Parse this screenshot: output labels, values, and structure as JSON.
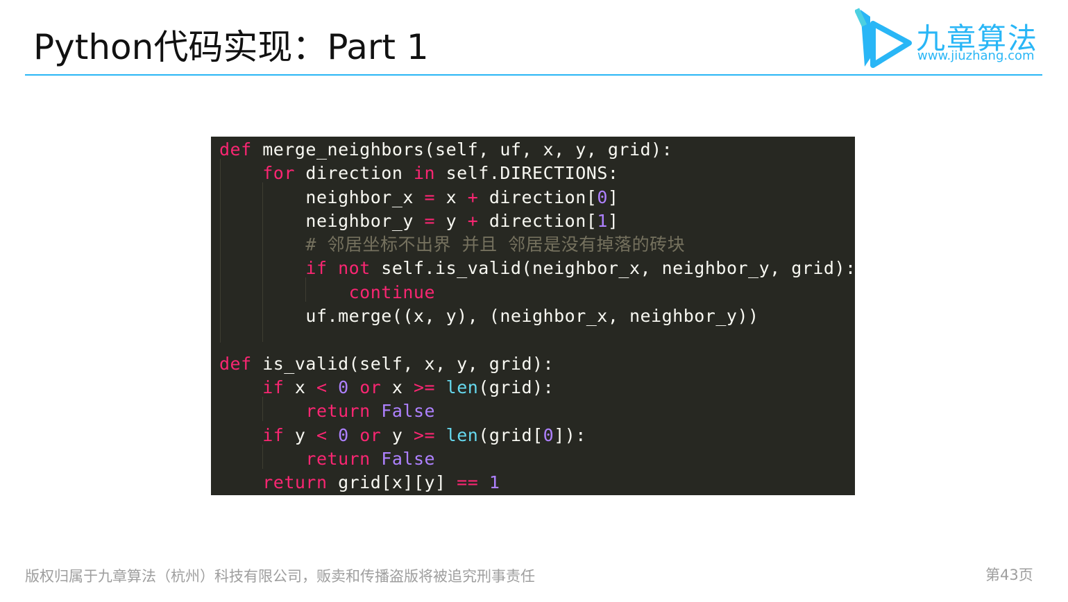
{
  "slide": {
    "title": "Python代码实现：Part 1",
    "page_label": "第43页",
    "footer_text": "版权归属于九章算法（杭州）科技有限公司，贩卖和传播盗版将被追究刑事责任"
  },
  "logo": {
    "name": "九章算法",
    "url": "www.jiuzhang.com",
    "icon": "jiuzhang-logo-icon"
  },
  "code": {
    "lines": [
      [
        {
          "t": "def",
          "c": "kw"
        },
        {
          "t": " merge_neighbors(self, uf, x, y, grid):",
          "c": ""
        }
      ],
      [
        {
          "t": "    ",
          "c": ""
        },
        {
          "t": "for",
          "c": "kw"
        },
        {
          "t": " direction ",
          "c": ""
        },
        {
          "t": "in",
          "c": "kw"
        },
        {
          "t": " self.DIRECTIONS:",
          "c": ""
        }
      ],
      [
        {
          "t": "        neighbor_x ",
          "c": ""
        },
        {
          "t": "=",
          "c": "op"
        },
        {
          "t": " x ",
          "c": ""
        },
        {
          "t": "+",
          "c": "op"
        },
        {
          "t": " direction[",
          "c": ""
        },
        {
          "t": "0",
          "c": "num"
        },
        {
          "t": "]",
          "c": ""
        }
      ],
      [
        {
          "t": "        neighbor_y ",
          "c": ""
        },
        {
          "t": "=",
          "c": "op"
        },
        {
          "t": " y ",
          "c": ""
        },
        {
          "t": "+",
          "c": "op"
        },
        {
          "t": " direction[",
          "c": ""
        },
        {
          "t": "1",
          "c": "num"
        },
        {
          "t": "]",
          "c": ""
        }
      ],
      [
        {
          "t": "        ",
          "c": ""
        },
        {
          "t": "# 邻居坐标不出界 并且 邻居是没有掉落的砖块",
          "c": "cmt"
        }
      ],
      [
        {
          "t": "        ",
          "c": ""
        },
        {
          "t": "if",
          "c": "kw"
        },
        {
          "t": " ",
          "c": ""
        },
        {
          "t": "not",
          "c": "kw"
        },
        {
          "t": " self.is_valid(neighbor_x, neighbor_y, grid):",
          "c": ""
        }
      ],
      [
        {
          "t": "            ",
          "c": ""
        },
        {
          "t": "continue",
          "c": "kw"
        }
      ],
      [
        {
          "t": "        uf.merge((x, y), (neighbor_x, neighbor_y))",
          "c": ""
        }
      ],
      [
        {
          "t": "",
          "c": ""
        }
      ],
      [
        {
          "t": "def",
          "c": "kw"
        },
        {
          "t": " is_valid(self, x, y, grid):",
          "c": ""
        }
      ],
      [
        {
          "t": "    ",
          "c": ""
        },
        {
          "t": "if",
          "c": "kw"
        },
        {
          "t": " x ",
          "c": ""
        },
        {
          "t": "<",
          "c": "op"
        },
        {
          "t": " ",
          "c": ""
        },
        {
          "t": "0",
          "c": "num"
        },
        {
          "t": " ",
          "c": ""
        },
        {
          "t": "or",
          "c": "kw"
        },
        {
          "t": " x ",
          "c": ""
        },
        {
          "t": ">=",
          "c": "op"
        },
        {
          "t": " ",
          "c": ""
        },
        {
          "t": "len",
          "c": "fn"
        },
        {
          "t": "(grid):",
          "c": ""
        }
      ],
      [
        {
          "t": "        ",
          "c": ""
        },
        {
          "t": "return",
          "c": "kw"
        },
        {
          "t": " ",
          "c": ""
        },
        {
          "t": "False",
          "c": "const"
        }
      ],
      [
        {
          "t": "    ",
          "c": ""
        },
        {
          "t": "if",
          "c": "kw"
        },
        {
          "t": " y ",
          "c": ""
        },
        {
          "t": "<",
          "c": "op"
        },
        {
          "t": " ",
          "c": ""
        },
        {
          "t": "0",
          "c": "num"
        },
        {
          "t": " ",
          "c": ""
        },
        {
          "t": "or",
          "c": "kw"
        },
        {
          "t": " y ",
          "c": ""
        },
        {
          "t": ">=",
          "c": "op"
        },
        {
          "t": " ",
          "c": ""
        },
        {
          "t": "len",
          "c": "fn"
        },
        {
          "t": "(grid[",
          "c": ""
        },
        {
          "t": "0",
          "c": "num"
        },
        {
          "t": "]):",
          "c": ""
        }
      ],
      [
        {
          "t": "        ",
          "c": ""
        },
        {
          "t": "return",
          "c": "kw"
        },
        {
          "t": " ",
          "c": ""
        },
        {
          "t": "False",
          "c": "const"
        }
      ],
      [
        {
          "t": "    ",
          "c": ""
        },
        {
          "t": "return",
          "c": "kw"
        },
        {
          "t": " grid[x][y] ",
          "c": ""
        },
        {
          "t": "==",
          "c": "op"
        },
        {
          "t": " ",
          "c": ""
        },
        {
          "t": "1",
          "c": "num"
        }
      ]
    ]
  }
}
